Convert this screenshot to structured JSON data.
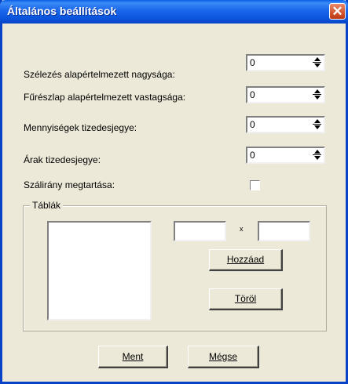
{
  "window": {
    "title": "Általános beállítások",
    "close_glyph": "✕"
  },
  "fields": [
    {
      "label": "Szélezés alapértelmezett nagysága:",
      "value": "0"
    },
    {
      "label": "Fűrészlap alapértelmezett vastagsága:",
      "value": "0"
    },
    {
      "label": "Mennyiségek tizedesjegye:",
      "value": "0"
    },
    {
      "label": "Árak tizedesjegye:",
      "value": "0"
    }
  ],
  "grain": {
    "label": "Szálirány megtartása:",
    "checked": false
  },
  "tables": {
    "group_title": "Táblák",
    "separator": "x",
    "width_value": "",
    "height_value": "",
    "add_label": "Hozzáad",
    "delete_label": "Töröl"
  },
  "footer": {
    "save_label": "Ment",
    "cancel_label": "Mégse"
  }
}
